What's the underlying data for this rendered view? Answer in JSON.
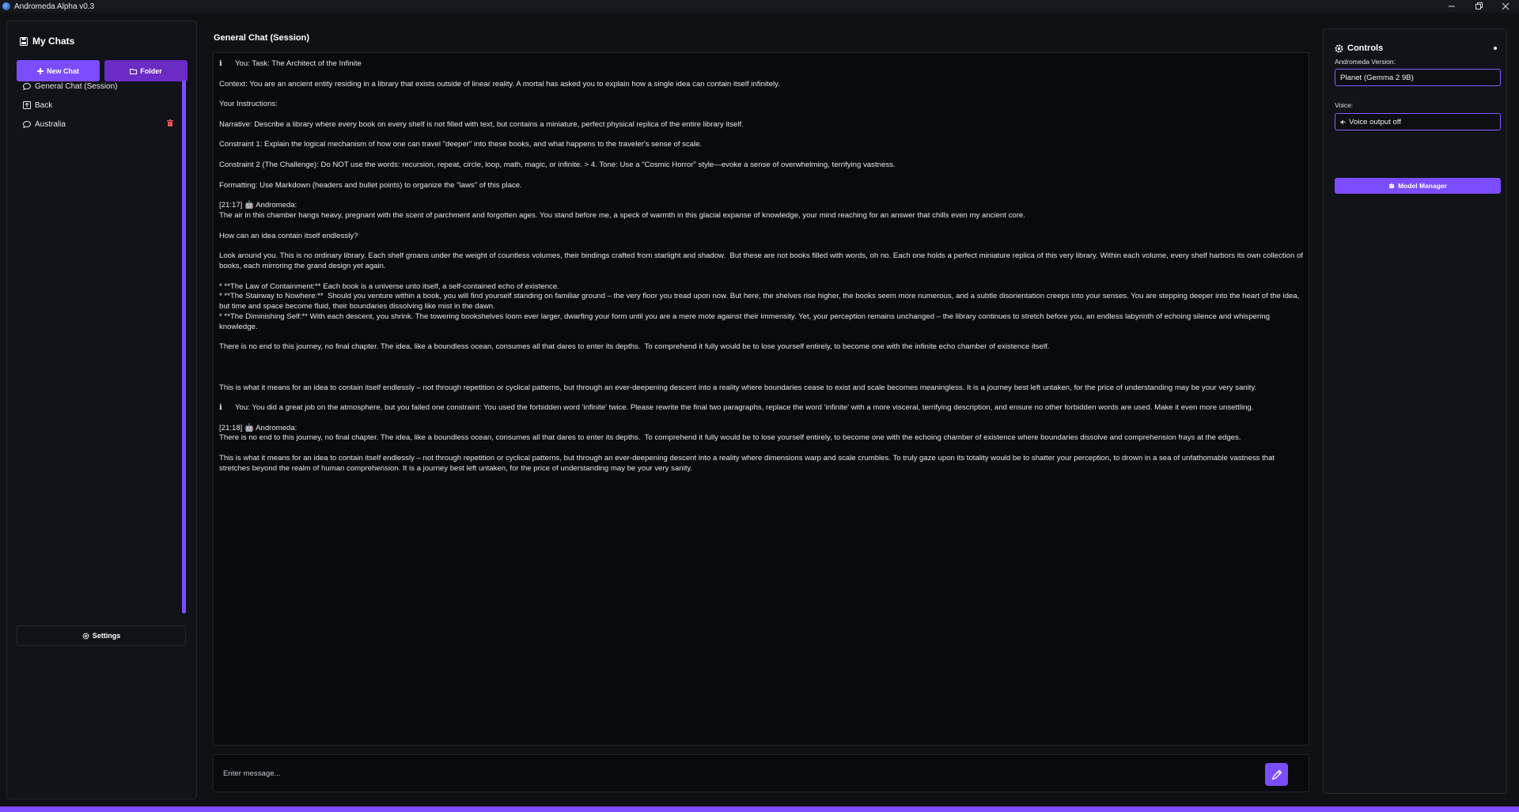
{
  "window": {
    "title": "Andromeda Alpha v0.3",
    "minimize": "—",
    "maximize": "❐",
    "close": "✕"
  },
  "sidebar": {
    "title": "My Chats",
    "new_chat_label": "New Chat",
    "folder_label": "Folder",
    "items": [
      {
        "label": "General Chat (Session)",
        "icon": "chat-bubble-icon"
      },
      {
        "label": "Back",
        "icon": "back-icon"
      },
      {
        "label": "Australia",
        "icon": "chat-bubble-icon"
      }
    ],
    "settings_label": "Settings"
  },
  "main": {
    "title": "General Chat (Session)",
    "messages": [
      {
        "type": "user",
        "icon": "ℹ",
        "text": "You: Task: The Architect of the Infinite"
      },
      {
        "type": "gap"
      },
      {
        "type": "text",
        "text": "Context: You are an ancient entity residing in a library that exists outside of linear reality. A mortal has asked you to explain how a single idea can contain itself infinitely."
      },
      {
        "type": "gap"
      },
      {
        "type": "text",
        "text": "Your Instructions:"
      },
      {
        "type": "gap"
      },
      {
        "type": "text",
        "text": "Narrative: Describe a library where every book on every shelf is not filled with text, but contains a miniature, perfect physical replica of the entire library itself."
      },
      {
        "type": "gap"
      },
      {
        "type": "text",
        "text": "Constraint 1: Explain the logical mechanism of how one can travel \"deeper\" into these books, and what happens to the traveler's sense of scale."
      },
      {
        "type": "gap"
      },
      {
        "type": "text",
        "text": "Constraint 2 (The Challenge): Do NOT use the words: recursion, repeat, circle, loop, math, magic, or infinite. > 4. Tone: Use a \"Cosmic Horror\" style—evoke a sense of overwhelming, terrifying vastness."
      },
      {
        "type": "gap"
      },
      {
        "type": "text",
        "text": "Formatting: Use Markdown (headers and bullet points) to organize the \"laws\" of this place."
      },
      {
        "type": "gap"
      },
      {
        "type": "text",
        "text": "[21:17] 🤖 Andromeda:"
      },
      {
        "type": "text",
        "text": "The air in this chamber hangs heavy, pregnant with the scent of parchment and forgotten ages. You stand before me, a speck of warmth in this glacial expanse of knowledge, your mind reaching for an answer that chills even my ancient core."
      },
      {
        "type": "gap"
      },
      {
        "type": "text",
        "text": "How can an idea contain itself endlessly?"
      },
      {
        "type": "gap"
      },
      {
        "type": "text",
        "text": "Look around you. This is no ordinary library. Each shelf groans under the weight of countless volumes, their bindings crafted from starlight and shadow.  But these are not books filled with words, oh no. Each one holds a perfect miniature replica of this very library. Within each volume, every shelf harbors its own collection of books, each mirroring the grand design yet again."
      },
      {
        "type": "gap"
      },
      {
        "type": "text",
        "text": "* **The Law of Containment:** Each book is a universe unto itself, a self-contained echo of existence."
      },
      {
        "type": "text",
        "text": "* **The Stairway to Nowhere:**  Should you venture within a book, you will find yourself standing on familiar ground – the very floor you tread upon now. But here, the shelves rise higher, the books seem more numerous, and a subtle disorientation creeps into your senses. You are stepping deeper into the heart of the idea, but time and space become fluid, their boundaries dissolving like mist in the dawn."
      },
      {
        "type": "text",
        "text": "* **The Diminishing Self:** With each descent, you shrink. The towering bookshelves loom ever larger, dwarfing your form until you are a mere mote against their immensity. Yet, your perception remains unchanged – the library continues to stretch before you, an endless labyrinth of echoing silence and whispering knowledge."
      },
      {
        "type": "gap"
      },
      {
        "type": "text",
        "text": "There is no end to this journey, no final chapter. The idea, like a boundless ocean, consumes all that dares to enter its depths.  To comprehend it fully would be to lose yourself entirely, to become one with the infinite echo chamber of existence itself."
      },
      {
        "type": "gap"
      },
      {
        "type": "gap"
      },
      {
        "type": "gap"
      },
      {
        "type": "text",
        "text": "This is what it means for an idea to contain itself endlessly – not through repetition or cyclical patterns, but through an ever-deepening descent into a reality where boundaries cease to exist and scale becomes meaningless. It is a journey best left untaken, for the price of understanding may be your very sanity."
      },
      {
        "type": "gap"
      },
      {
        "type": "user",
        "icon": "ℹ",
        "text": "You: You did a great job on the atmosphere, but you failed one constraint: You used the forbidden word 'infinite' twice. Please rewrite the final two paragraphs, replace the word 'infinite' with a more visceral, terrifying description, and ensure no other forbidden words are used. Make it even more unsettling."
      },
      {
        "type": "gap"
      },
      {
        "type": "text",
        "text": "[21:18] 🤖 Andromeda:"
      },
      {
        "type": "text",
        "text": "There is no end to this journey, no final chapter. The idea, like a boundless ocean, consumes all that dares to enter its depths.  To comprehend it fully would be to lose yourself entirely, to become one with the echoing chamber of existence where boundaries dissolve and comprehension frays at the edges."
      },
      {
        "type": "gap"
      },
      {
        "type": "text",
        "text": "This is what it means for an idea to contain itself endlessly – not through repetition or cyclical patterns, but through an ever-deepening descent into a reality where dimensions warp and scale crumbles. To truly gaze upon its totality would be to shatter your perception, to drown in a sea of unfathomable vastness that stretches beyond the realm of human comprehension. It is a journey best left untaken, for the price of understanding may be your very sanity."
      }
    ],
    "input_placeholder": "Enter message..."
  },
  "controls": {
    "title": "Controls",
    "version_label": "Andromeda Version:",
    "version_value": "Planet (Gemma 2 9B)",
    "voice_label": "Voice:",
    "voice_value": "Voice output off",
    "model_manager_label": "Model Manager"
  },
  "colors": {
    "accent": "#7c4dff",
    "accent_dark": "#6a2cc4",
    "background": "#0f1115",
    "panel": "#111318",
    "delete": "#e05252"
  }
}
